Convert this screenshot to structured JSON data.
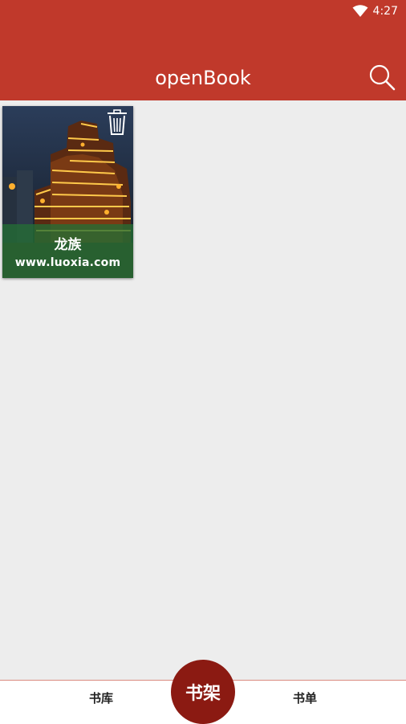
{
  "status_bar": {
    "time": "4:27",
    "wifi_icon": "wifi-icon"
  },
  "app_bar": {
    "title": "openBook",
    "search_icon": "search-icon"
  },
  "bookshelf": {
    "books": [
      {
        "title": "龙族",
        "source": "www.luoxia.com",
        "delete_icon": "trash-icon"
      }
    ]
  },
  "bottom_nav": {
    "items": [
      {
        "label": "书库"
      },
      {
        "label": "书架",
        "active": true
      },
      {
        "label": "书单"
      }
    ]
  },
  "colors": {
    "primary": "#c0392b",
    "active_tab": "#8b1a12",
    "background": "#ededed"
  }
}
